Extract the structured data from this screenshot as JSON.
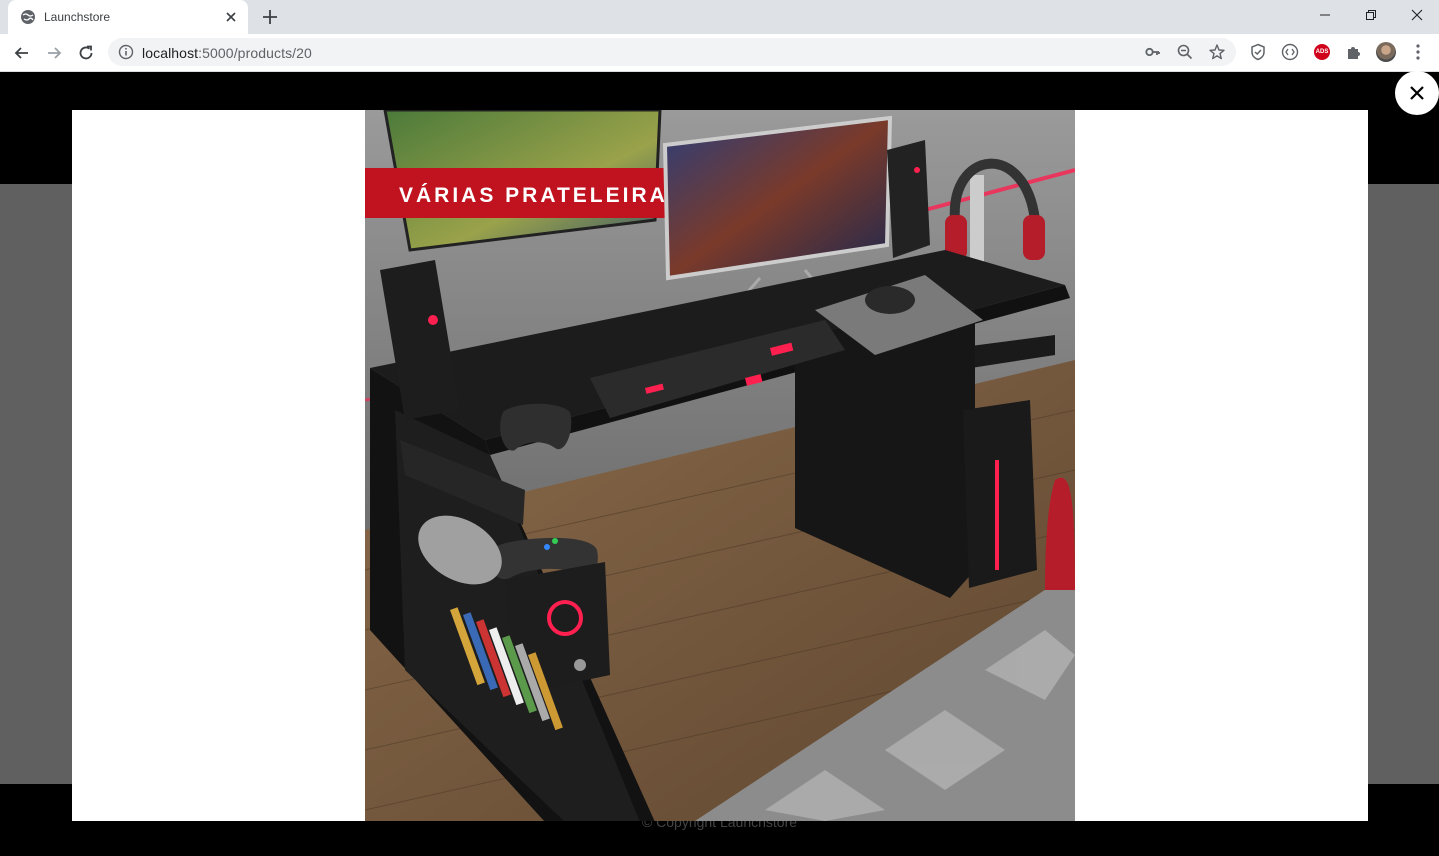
{
  "browser": {
    "tab_title": "Launchstore",
    "url_host": "localhost",
    "url_path": ":5000/products/20",
    "ext_ads_label": "ADS"
  },
  "product_image": {
    "banner_text": "VÁRIAS PRATELEIRAS",
    "description_icons": [
      "monitor",
      "gaming-desk",
      "keyboard",
      "mouse",
      "headset",
      "controllers",
      "speaker",
      "books"
    ]
  },
  "footer": {
    "copyright": "© Copyright Launchstore"
  },
  "colors": {
    "overlay": "#000000",
    "lightbox_bg": "#ffffff",
    "banner_red": "#c1121f"
  }
}
